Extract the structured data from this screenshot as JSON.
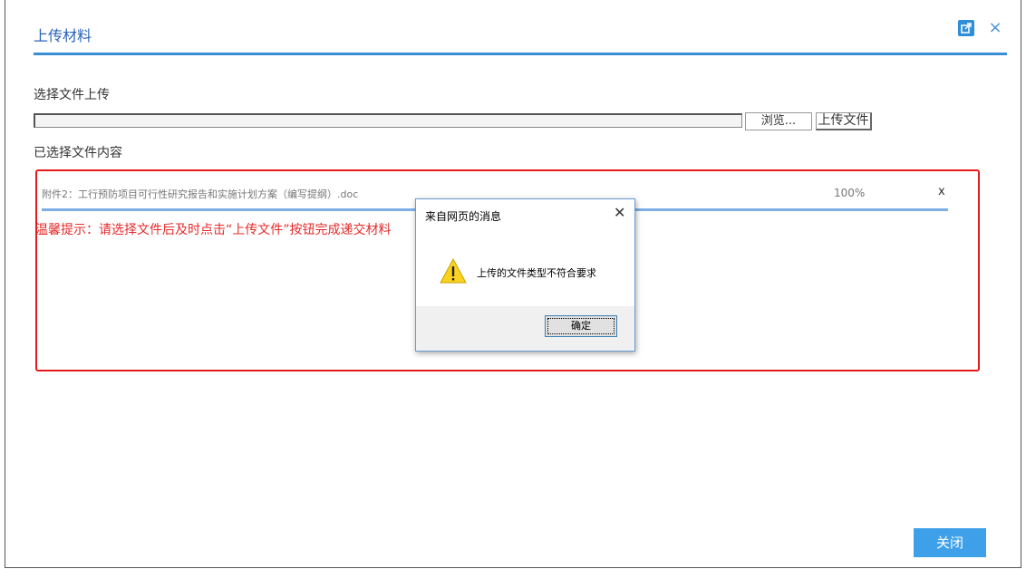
{
  "window": {
    "title": "上传材料",
    "close_glyph": "×"
  },
  "upload": {
    "select_label": "选择文件上传",
    "browse_label": "浏览...",
    "upload_label": "上传文件",
    "selected_label": "已选择文件内容"
  },
  "file": {
    "name": "附件2：工行预防项目可行性研究报告和实施计划方案（编写提纲）.doc",
    "percent": "100%",
    "progress_fraction": 1.0,
    "remove_label": "x"
  },
  "notice": "温馨提示：请选择文件后及时点击“上传文件”按钮完成递交材料",
  "footer": {
    "close_label": "关闭"
  },
  "dialog": {
    "title": "来自网页的消息",
    "close_glyph": "✕",
    "message": "上传的文件类型不符合要求",
    "ok_label": "确定",
    "icon": "warning-icon"
  },
  "colors": {
    "accent": "#3a8fd4",
    "alert_red": "#e51b1b",
    "close_button": "#3ea0e8"
  }
}
